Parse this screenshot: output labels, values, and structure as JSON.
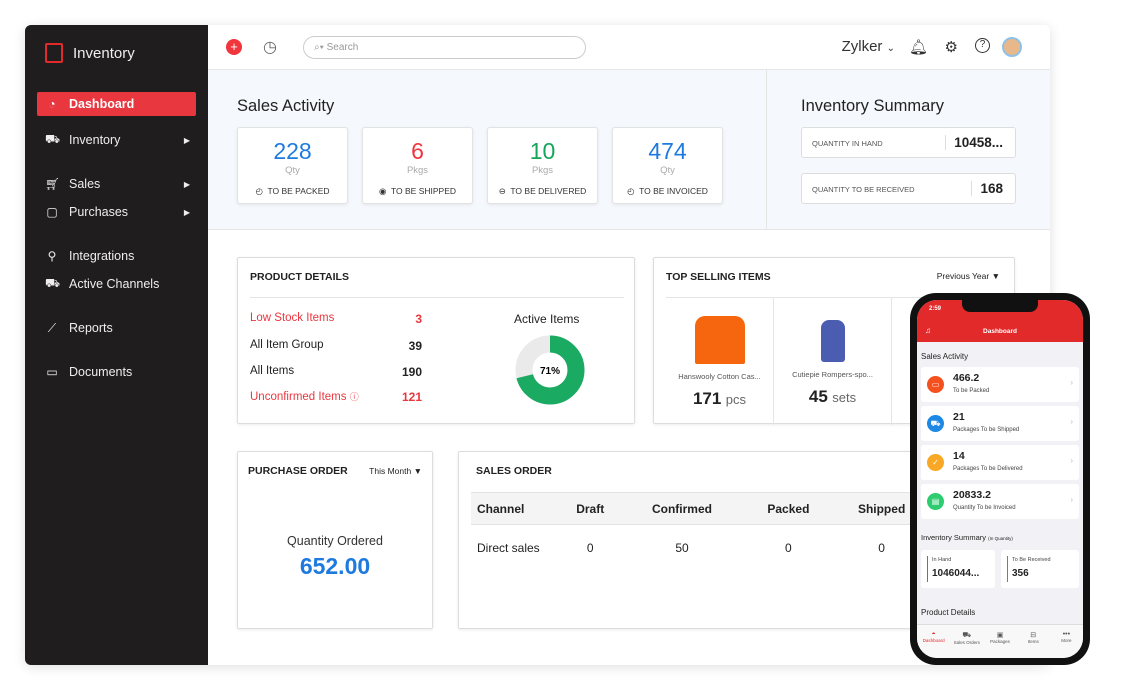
{
  "app": {
    "title": "Inventory"
  },
  "sidebar": {
    "items": [
      {
        "label": "Dashboard",
        "icon": "dashboard-icon"
      },
      {
        "label": "Inventory",
        "icon": "cart-icon"
      },
      {
        "label": "Sales",
        "icon": "cart-icon"
      },
      {
        "label": "Purchases",
        "icon": "bag-icon"
      },
      {
        "label": "Integrations",
        "icon": "integration-icon"
      },
      {
        "label": "Active Channels",
        "icon": "channels-icon"
      },
      {
        "label": "Reports",
        "icon": "chart-icon"
      },
      {
        "label": "Documents",
        "icon": "folder-icon"
      }
    ]
  },
  "header": {
    "search_placeholder": "Search",
    "org": "Zylker"
  },
  "sales_activity": {
    "title": "Sales Activity",
    "cards": [
      {
        "value": "228",
        "unit": "Qty",
        "label": "TO BE PACKED",
        "color": "#1f7ae0"
      },
      {
        "value": "6",
        "unit": "Pkgs",
        "label": "TO BE SHIPPED",
        "color": "#f0353c"
      },
      {
        "value": "10",
        "unit": "Pkgs",
        "label": "TO BE DELIVERED",
        "color": "#14a55a"
      },
      {
        "value": "474",
        "unit": "Qty",
        "label": "TO BE INVOICED",
        "color": "#1f7ae0"
      }
    ]
  },
  "inventory_summary": {
    "title": "Inventory Summary",
    "items": [
      {
        "label": "QUANTITY IN HAND",
        "value": "10458..."
      },
      {
        "label": "QUANTITY TO BE RECEIVED",
        "value": "168"
      }
    ]
  },
  "product_details": {
    "title": "PRODUCT DETAILS",
    "rows": [
      {
        "label": "Low Stock Items",
        "value": "3"
      },
      {
        "label": "All Item Group",
        "value": "39"
      },
      {
        "label": "All Items",
        "value": "190"
      },
      {
        "label": "Unconfirmed Items",
        "value": "121"
      }
    ],
    "active_title": "Active Items",
    "active_pct": "71%",
    "active_fraction": 0.71
  },
  "top_selling": {
    "title": "TOP SELLING ITEMS",
    "period": "Previous Year",
    "items": [
      {
        "name": "Hanswooly Cotton Cas...",
        "qty": "171",
        "unit": "pcs"
      },
      {
        "name": "Cutiepie Rompers-spo...",
        "qty": "45",
        "unit": "sets"
      }
    ]
  },
  "purchase_order": {
    "title": "PURCHASE ORDER",
    "period": "This Month",
    "label": "Quantity Ordered",
    "value": "652.00"
  },
  "sales_order": {
    "title": "SALES ORDER",
    "headers": [
      "Channel",
      "Draft",
      "Confirmed",
      "Packed",
      "Shipped"
    ],
    "rows": [
      [
        "Direct sales",
        "0",
        "50",
        "0",
        "0"
      ]
    ]
  },
  "mobile": {
    "time": "2:59",
    "title": "Dashboard",
    "sales_title": "Sales Activity",
    "cards": [
      {
        "value": "466.2",
        "label": "To be Packed",
        "color": "#f4511e"
      },
      {
        "value": "21",
        "label": "Packages To be Shipped",
        "color": "#1e88e5"
      },
      {
        "value": "14",
        "label": "Packages To be Delivered",
        "color": "#f9a825"
      },
      {
        "value": "20833.2",
        "label": "Quantity To be Invoiced",
        "color": "#2ecc71"
      }
    ],
    "inv_title": "Inventory Summary",
    "inv_sub": "(In Quantity)",
    "in_hand_label": "In Hand",
    "in_hand": "1046044...",
    "to_receive_label": "To Be Received",
    "to_receive": "356",
    "product_title": "Product Details",
    "tabs": [
      "Dashboard",
      "Sales Orders",
      "Packages",
      "Items",
      "More"
    ]
  }
}
